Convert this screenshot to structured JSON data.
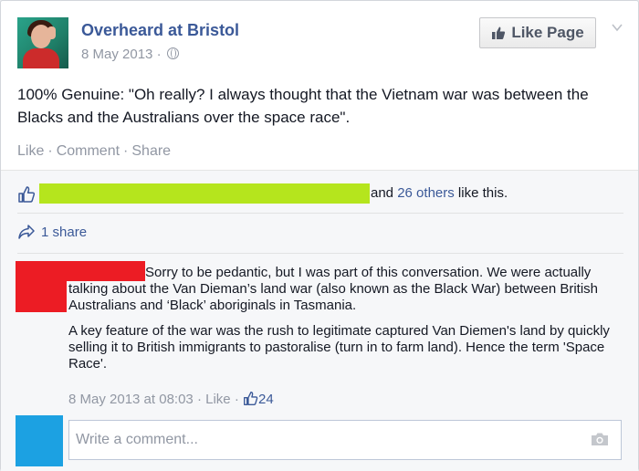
{
  "post": {
    "page_name": "Overheard at Bristol",
    "date": "8 May 2013",
    "date_separator": "·",
    "like_page_label": "Like Page",
    "text": "100% Genuine: \"Oh really? I always thought that the Vietnam war was between the Blacks and the Australians over the space race\".",
    "actions": {
      "like": "Like",
      "comment": "Comment",
      "share": "Share",
      "separator": "·"
    }
  },
  "feedback": {
    "likes_and": "and",
    "likes_others": "26 others",
    "likes_suffix": "like this.",
    "shares": "1 share"
  },
  "comment": {
    "paragraph_1": "Sorry to be pedantic, but I was part of this conversation. We were actually talking about the Van Dieman’s land war (also known as the Black War) between British Australians and ‘Black’ aboriginals in Tasmania.",
    "paragraph_2": "A key feature of the war was the rush to legitimate captured Van Diemen's land by quickly selling it to British immigrants to pastoralise (turn in to farm land). Hence the term 'Space Race'.",
    "timestamp": "8 May 2013 at 08:03",
    "separator": "·",
    "like_label": "Like",
    "like_count": "24"
  },
  "write_comment": {
    "placeholder": "Write a comment..."
  },
  "colors": {
    "link_blue": "#3b5998",
    "redaction_green": "#b5e51d",
    "redaction_red": "#ec1c24",
    "user_avatar_blue": "#1ca1e2"
  },
  "icons": [
    "globe-icon",
    "thumbs-up-icon",
    "chevron-down-icon",
    "share-arrow-icon",
    "camera-icon"
  ]
}
